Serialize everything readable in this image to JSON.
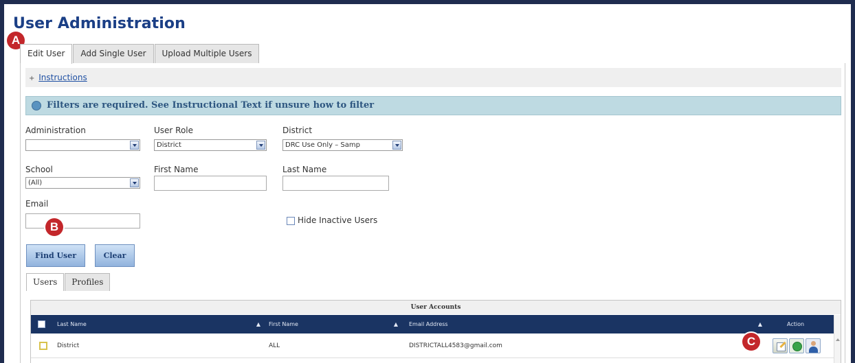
{
  "page": {
    "title": "User Administration"
  },
  "markers": {
    "a": "A",
    "b": "B",
    "c": "C"
  },
  "main_tabs": [
    {
      "label": "Edit User",
      "active": true
    },
    {
      "label": "Add Single User",
      "active": false
    },
    {
      "label": "Upload Multiple Users",
      "active": false
    }
  ],
  "instructions": {
    "toggle": "+",
    "link": "Instructions"
  },
  "filter_notice": "Filters are required. See Instructional Text if unsure how to filter",
  "filters": {
    "administration": {
      "label": "Administration",
      "value": ""
    },
    "user_role": {
      "label": "User Role",
      "value": "District"
    },
    "district": {
      "label": "District",
      "value": "DRC Use Only – Samp"
    },
    "school": {
      "label": "School",
      "value": "(All)"
    },
    "first_name": {
      "label": "First Name",
      "value": ""
    },
    "last_name": {
      "label": "Last Name",
      "value": ""
    },
    "email": {
      "label": "Email",
      "value": ""
    },
    "hide_inactive": {
      "label": "Hide Inactive Users",
      "checked": false
    }
  },
  "buttons": {
    "find_user": "Find User",
    "clear": "Clear"
  },
  "sub_tabs": [
    {
      "label": "Users",
      "active": true
    },
    {
      "label": "Profiles",
      "active": false
    }
  ],
  "grid": {
    "caption": "User Accounts",
    "columns": {
      "last_name": "Last Name",
      "first_name": "First Name",
      "email": "Email Address",
      "action": "Action"
    },
    "sort_arrow": "▲",
    "rows": [
      {
        "last_name": "District",
        "first_name": "ALL",
        "email": "DISTRICTALL4583@gmail.com"
      }
    ]
  },
  "icons": {
    "info": "info-icon",
    "dropdown": "chevron-down-icon",
    "edit": "edit-icon",
    "reset_password": "reset-password-icon",
    "user_profile": "user-profile-icon"
  },
  "colors": {
    "title": "#1b3f86",
    "header_bar": "#1a3463",
    "notice_bg": "#bedae2",
    "marker": "#c3272b",
    "frame": "#1f2c4f"
  }
}
